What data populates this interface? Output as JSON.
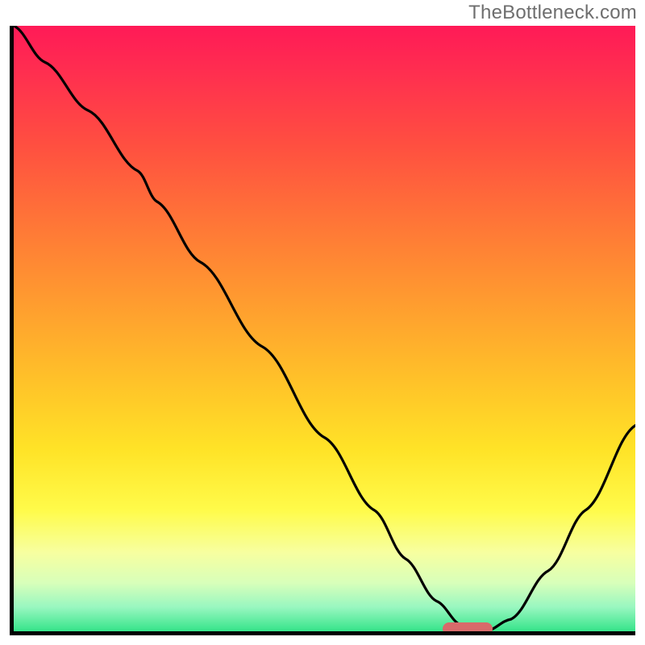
{
  "watermark": "TheBottleneck.com",
  "colors": {
    "axis": "#000000",
    "curve": "#000000",
    "marker": "#d86a6a",
    "gradient_top": "#ff1a57",
    "gradient_bottom": "#35e48a"
  },
  "chart_data": {
    "type": "line",
    "title": "",
    "xlabel": "",
    "ylabel": "",
    "xlim": [
      0,
      100
    ],
    "ylim": [
      0,
      100
    ],
    "x": [
      0,
      5,
      12,
      20,
      23,
      30,
      40,
      50,
      58,
      63,
      68,
      72,
      76,
      80,
      86,
      92,
      100
    ],
    "values": [
      100,
      94,
      86,
      76,
      71,
      61,
      47,
      32,
      20,
      12,
      5,
      1,
      0,
      2,
      10,
      20,
      34
    ],
    "marker": {
      "x_start": 69,
      "x_end": 77,
      "y": 0
    },
    "background_gradient": {
      "direction": "vertical",
      "stops": [
        {
          "pos": 0.0,
          "color": "#ff1a57"
        },
        {
          "pos": 0.2,
          "color": "#ff5040"
        },
        {
          "pos": 0.46,
          "color": "#ff9d2f"
        },
        {
          "pos": 0.7,
          "color": "#ffe327"
        },
        {
          "pos": 0.87,
          "color": "#f7ffa0"
        },
        {
          "pos": 1.0,
          "color": "#35e48a"
        }
      ]
    }
  }
}
